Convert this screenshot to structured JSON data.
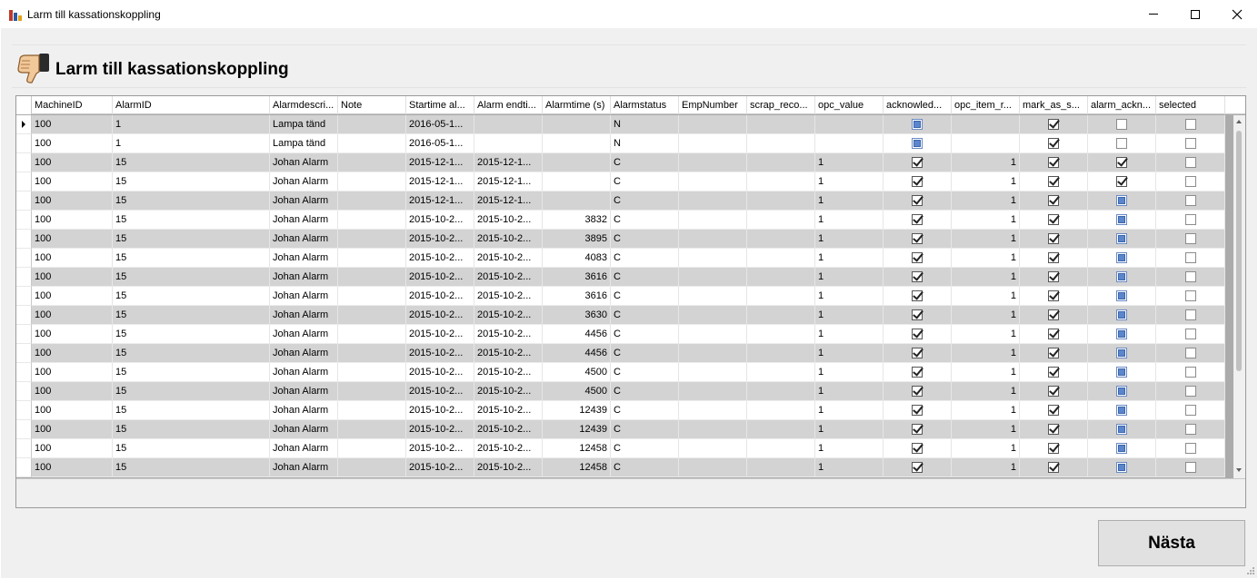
{
  "window": {
    "title": "Larm till kassationskoppling"
  },
  "page": {
    "title": "Larm till kassationskoppling"
  },
  "columns": [
    {
      "key": "machine",
      "label": "MachineID",
      "width": 89
    },
    {
      "key": "alarm",
      "label": "AlarmID",
      "width": 173
    },
    {
      "key": "desc",
      "label": "Alarmdescri...",
      "width": 75
    },
    {
      "key": "note",
      "label": "Note",
      "width": 75
    },
    {
      "key": "start",
      "label": "Startime al...",
      "width": 75
    },
    {
      "key": "end",
      "label": "Alarm endti...",
      "width": 75
    },
    {
      "key": "time",
      "label": "Alarmtime (s)",
      "width": 75
    },
    {
      "key": "status",
      "label": "Alarmstatus",
      "width": 75
    },
    {
      "key": "emp",
      "label": "EmpNumber",
      "width": 75
    },
    {
      "key": "scrap",
      "label": "scrap_reco...",
      "width": 75
    },
    {
      "key": "opc",
      "label": "opc_value",
      "width": 75
    },
    {
      "key": "ack",
      "label": "acknowled...",
      "width": 75
    },
    {
      "key": "opcitem",
      "label": "opc_item_r...",
      "width": 75
    },
    {
      "key": "mark",
      "label": "mark_as_s...",
      "width": 75
    },
    {
      "key": "aack",
      "label": "alarm_ackn...",
      "width": 75
    },
    {
      "key": "sel",
      "label": "selected",
      "width": 76
    }
  ],
  "rows": [
    {
      "machine": "100",
      "alarm": "1",
      "desc": "Lampa tänd",
      "note": "",
      "start": "2016-05-1...",
      "end": "",
      "time": "",
      "status": "N",
      "emp": "",
      "scrap": "",
      "opc": "",
      "ack": "ind",
      "opcitem": "",
      "mark": "chk",
      "aack": "unc",
      "sel": "unc"
    },
    {
      "machine": "100",
      "alarm": "1",
      "desc": "Lampa tänd",
      "note": "",
      "start": "2016-05-1...",
      "end": "",
      "time": "",
      "status": "N",
      "emp": "",
      "scrap": "",
      "opc": "",
      "ack": "ind",
      "opcitem": "",
      "mark": "chk",
      "aack": "unc",
      "sel": "unc"
    },
    {
      "machine": "100",
      "alarm": "15",
      "desc": "Johan Alarm",
      "note": "",
      "start": "2015-12-1...",
      "end": "2015-12-1...",
      "time": "",
      "status": "C",
      "emp": "",
      "scrap": "",
      "opc": "1",
      "ack": "chk",
      "opcitem": "1",
      "mark": "chk",
      "aack": "chk",
      "sel": "unc"
    },
    {
      "machine": "100",
      "alarm": "15",
      "desc": "Johan Alarm",
      "note": "",
      "start": "2015-12-1...",
      "end": "2015-12-1...",
      "time": "",
      "status": "C",
      "emp": "",
      "scrap": "",
      "opc": "1",
      "ack": "chk",
      "opcitem": "1",
      "mark": "chk",
      "aack": "chk",
      "sel": "unc"
    },
    {
      "machine": "100",
      "alarm": "15",
      "desc": "Johan Alarm",
      "note": "",
      "start": "2015-12-1...",
      "end": "2015-12-1...",
      "time": "",
      "status": "C",
      "emp": "",
      "scrap": "",
      "opc": "1",
      "ack": "chk",
      "opcitem": "1",
      "mark": "chk",
      "aack": "ind",
      "sel": "unc"
    },
    {
      "machine": "100",
      "alarm": "15",
      "desc": "Johan Alarm",
      "note": "",
      "start": "2015-10-2...",
      "end": "2015-10-2...",
      "time": "3832",
      "status": "C",
      "emp": "",
      "scrap": "",
      "opc": "1",
      "ack": "chk",
      "opcitem": "1",
      "mark": "chk",
      "aack": "ind",
      "sel": "unc"
    },
    {
      "machine": "100",
      "alarm": "15",
      "desc": "Johan Alarm",
      "note": "",
      "start": "2015-10-2...",
      "end": "2015-10-2...",
      "time": "3895",
      "status": "C",
      "emp": "",
      "scrap": "",
      "opc": "1",
      "ack": "chk",
      "opcitem": "1",
      "mark": "chk",
      "aack": "ind",
      "sel": "unc"
    },
    {
      "machine": "100",
      "alarm": "15",
      "desc": "Johan Alarm",
      "note": "",
      "start": "2015-10-2...",
      "end": "2015-10-2...",
      "time": "4083",
      "status": "C",
      "emp": "",
      "scrap": "",
      "opc": "1",
      "ack": "chk",
      "opcitem": "1",
      "mark": "chk",
      "aack": "ind",
      "sel": "unc"
    },
    {
      "machine": "100",
      "alarm": "15",
      "desc": "Johan Alarm",
      "note": "",
      "start": "2015-10-2...",
      "end": "2015-10-2...",
      "time": "3616",
      "status": "C",
      "emp": "",
      "scrap": "",
      "opc": "1",
      "ack": "chk",
      "opcitem": "1",
      "mark": "chk",
      "aack": "ind",
      "sel": "unc"
    },
    {
      "machine": "100",
      "alarm": "15",
      "desc": "Johan Alarm",
      "note": "",
      "start": "2015-10-2...",
      "end": "2015-10-2...",
      "time": "3616",
      "status": "C",
      "emp": "",
      "scrap": "",
      "opc": "1",
      "ack": "chk",
      "opcitem": "1",
      "mark": "chk",
      "aack": "ind",
      "sel": "unc"
    },
    {
      "machine": "100",
      "alarm": "15",
      "desc": "Johan Alarm",
      "note": "",
      "start": "2015-10-2...",
      "end": "2015-10-2...",
      "time": "3630",
      "status": "C",
      "emp": "",
      "scrap": "",
      "opc": "1",
      "ack": "chk",
      "opcitem": "1",
      "mark": "chk",
      "aack": "ind",
      "sel": "unc"
    },
    {
      "machine": "100",
      "alarm": "15",
      "desc": "Johan Alarm",
      "note": "",
      "start": "2015-10-2...",
      "end": "2015-10-2...",
      "time": "4456",
      "status": "C",
      "emp": "",
      "scrap": "",
      "opc": "1",
      "ack": "chk",
      "opcitem": "1",
      "mark": "chk",
      "aack": "ind",
      "sel": "unc"
    },
    {
      "machine": "100",
      "alarm": "15",
      "desc": "Johan Alarm",
      "note": "",
      "start": "2015-10-2...",
      "end": "2015-10-2...",
      "time": "4456",
      "status": "C",
      "emp": "",
      "scrap": "",
      "opc": "1",
      "ack": "chk",
      "opcitem": "1",
      "mark": "chk",
      "aack": "ind",
      "sel": "unc"
    },
    {
      "machine": "100",
      "alarm": "15",
      "desc": "Johan Alarm",
      "note": "",
      "start": "2015-10-2...",
      "end": "2015-10-2...",
      "time": "4500",
      "status": "C",
      "emp": "",
      "scrap": "",
      "opc": "1",
      "ack": "chk",
      "opcitem": "1",
      "mark": "chk",
      "aack": "ind",
      "sel": "unc"
    },
    {
      "machine": "100",
      "alarm": "15",
      "desc": "Johan Alarm",
      "note": "",
      "start": "2015-10-2...",
      "end": "2015-10-2...",
      "time": "4500",
      "status": "C",
      "emp": "",
      "scrap": "",
      "opc": "1",
      "ack": "chk",
      "opcitem": "1",
      "mark": "chk",
      "aack": "ind",
      "sel": "unc"
    },
    {
      "machine": "100",
      "alarm": "15",
      "desc": "Johan Alarm",
      "note": "",
      "start": "2015-10-2...",
      "end": "2015-10-2...",
      "time": "12439",
      "status": "C",
      "emp": "",
      "scrap": "",
      "opc": "1",
      "ack": "chk",
      "opcitem": "1",
      "mark": "chk",
      "aack": "ind",
      "sel": "unc"
    },
    {
      "machine": "100",
      "alarm": "15",
      "desc": "Johan Alarm",
      "note": "",
      "start": "2015-10-2...",
      "end": "2015-10-2...",
      "time": "12439",
      "status": "C",
      "emp": "",
      "scrap": "",
      "opc": "1",
      "ack": "chk",
      "opcitem": "1",
      "mark": "chk",
      "aack": "ind",
      "sel": "unc"
    },
    {
      "machine": "100",
      "alarm": "15",
      "desc": "Johan Alarm",
      "note": "",
      "start": "2015-10-2...",
      "end": "2015-10-2...",
      "time": "12458",
      "status": "C",
      "emp": "",
      "scrap": "",
      "opc": "1",
      "ack": "chk",
      "opcitem": "1",
      "mark": "chk",
      "aack": "ind",
      "sel": "unc"
    },
    {
      "machine": "100",
      "alarm": "15",
      "desc": "Johan Alarm",
      "note": "",
      "start": "2015-10-2...",
      "end": "2015-10-2...",
      "time": "12458",
      "status": "C",
      "emp": "",
      "scrap": "",
      "opc": "1",
      "ack": "chk",
      "opcitem": "1",
      "mark": "chk",
      "aack": "ind",
      "sel": "unc"
    }
  ],
  "checkbox_columns": [
    "ack",
    "mark",
    "aack",
    "sel"
  ],
  "right_aligned_columns": [
    "time",
    "opcitem"
  ],
  "colors": {
    "row_alt": "#d3d3d3",
    "grid_bg": "#ababab",
    "window_bg": "#f0f0f0"
  },
  "icons": {
    "app": "bar-chart-icon",
    "header": "thumbs-down-icon"
  },
  "buttons": {
    "next_label": "Nästa"
  }
}
